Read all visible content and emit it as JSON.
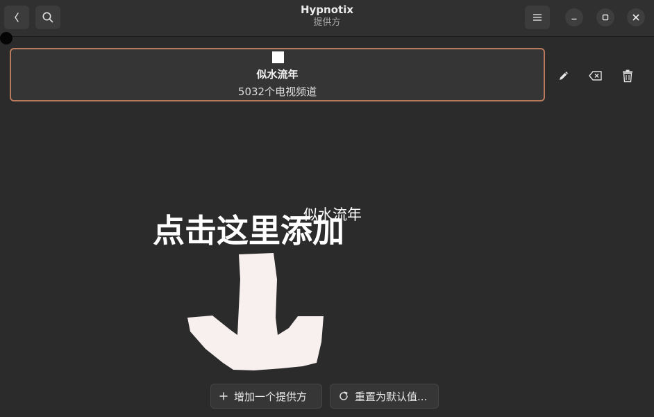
{
  "header": {
    "title": "Hypnotix",
    "subtitle": "提供方",
    "back_icon": "chevron-left-icon",
    "search_icon": "search-icon",
    "menu_icon": "hamburger-menu-icon",
    "window_controls": [
      "minimize-icon",
      "maximize-icon",
      "close-icon"
    ]
  },
  "provider": {
    "name": "似水流年",
    "channels": "5032个电视频道",
    "actions": [
      "edit-icon",
      "clear-icon",
      "trash-icon"
    ],
    "accent_color": "#b87a5c"
  },
  "annotation": {
    "main_text": "点击这里添加",
    "small_text": "似水流年"
  },
  "footer": {
    "add_label": "增加一个提供方",
    "reset_label": "重置为默认值..."
  }
}
